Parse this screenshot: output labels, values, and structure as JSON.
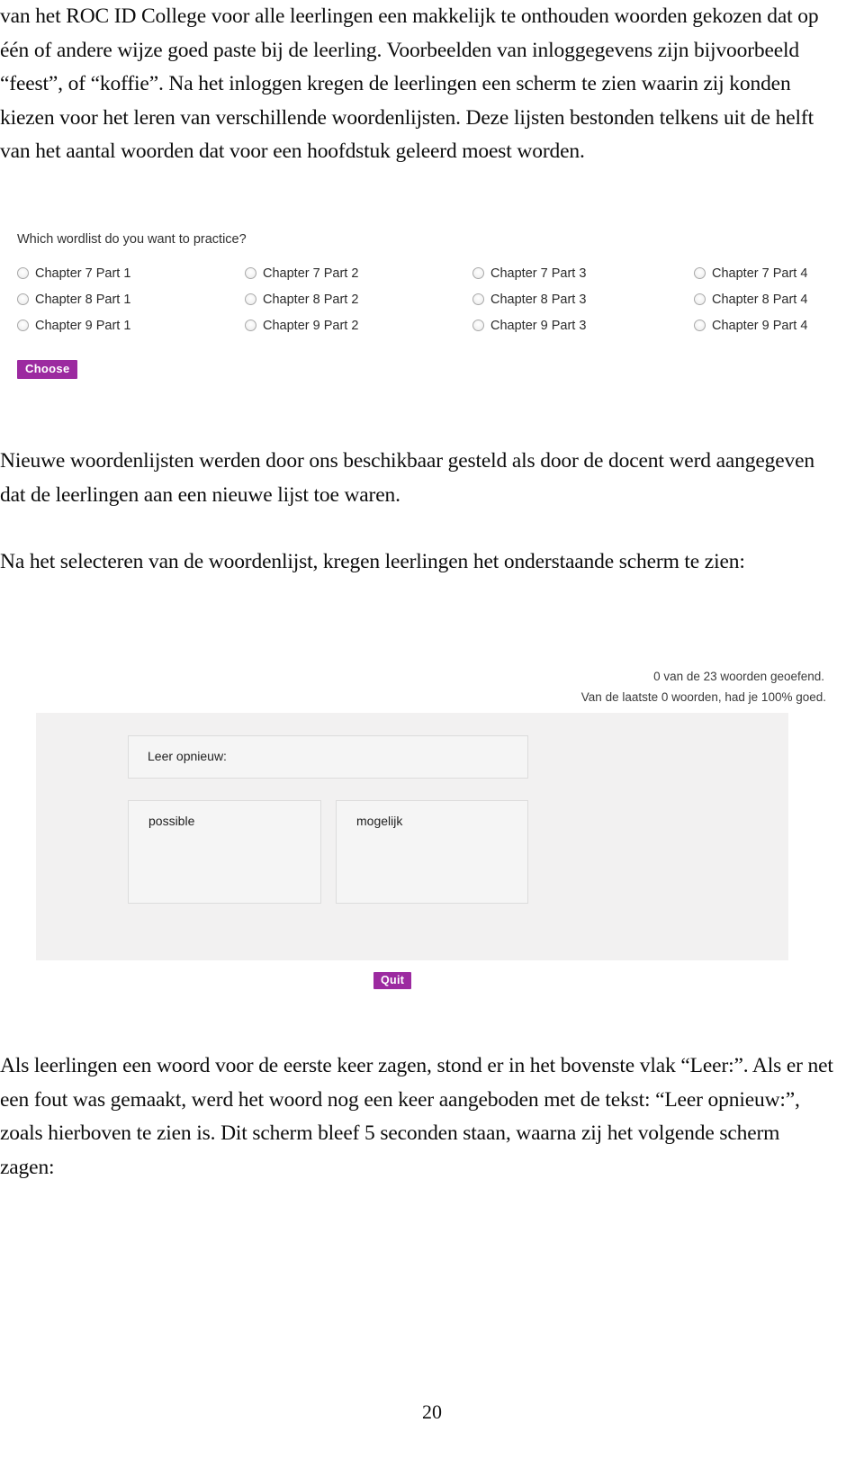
{
  "document": {
    "page_number": "20",
    "paragraphs": {
      "intro": "van het ROC ID College voor alle leerlingen een makkelijk te onthouden woorden gekozen dat op één of andere wijze goed paste bij de leerling. Voorbeelden van inloggegevens zijn bijvoorbeeld “feest”, of “koffie”. Na het inloggen kregen de leerlingen een scherm te zien waarin zij konden kiezen voor het leren van verschillende woordenlijsten. Deze lijsten bestonden telkens uit de helft van het aantal woorden dat voor een hoofdstuk geleerd moest worden.",
      "middle_a": "Nieuwe woordenlijsten werden door ons beschikbaar gesteld als door de docent werd aangegeven dat de leerlingen aan een nieuwe lijst toe waren.",
      "middle_b": "Na het selecteren van de woordenlijst, kregen leerlingen het onderstaande scherm te zien:",
      "bottom": "Als leerlingen een woord voor de eerste keer zagen, stond er in het bovenste vlak “Leer:”. Als er net een fout was gemaakt, werd het woord nog een keer aangeboden met de tekst: “Leer opnieuw:”, zoals hierboven te zien is. Dit scherm bleef 5 seconden staan, waarna zij het volgende scherm zagen:"
    }
  },
  "figure_wordlist": {
    "question": "Which wordlist do you want to practice?",
    "columns": [
      [
        "Chapter 7 Part 1",
        "Chapter 8 Part 1",
        "Chapter 9 Part 1"
      ],
      [
        "Chapter 7 Part 2",
        "Chapter 8 Part 2",
        "Chapter 9 Part 2"
      ],
      [
        "Chapter 7 Part 3",
        "Chapter 8 Part 3",
        "Chapter 9 Part 3"
      ],
      [
        "Chapter 7 Part 4",
        "Chapter 8 Part 4",
        "Chapter 9 Part 4"
      ]
    ],
    "rows": [
      [
        "Chapter 7 Part 1",
        "Chapter 7 Part 2",
        "Chapter 7 Part 3",
        "Chapter 7 Part 4"
      ],
      [
        "Chapter 8 Part 1",
        "Chapter 8 Part 2",
        "Chapter 8 Part 3",
        "Chapter 8 Part 4"
      ],
      [
        "Chapter 9 Part 1",
        "Chapter 9 Part 2",
        "Chapter 9 Part 3",
        "Chapter 9 Part 4"
      ]
    ],
    "choose_label": "Choose",
    "accent_color": "#9c2aa0"
  },
  "figure_practice": {
    "status_line_1": "0 van de 23 woorden geoefend.",
    "status_line_2": "Van de laatste 0 woorden, had je 100% goed.",
    "prompt_label": "Leer opnieuw:",
    "word_source": "possible",
    "word_target": "mogelijk",
    "quit_label": "Quit",
    "accent_color": "#9c2aa0",
    "panel_color": "#f2f1f1"
  }
}
